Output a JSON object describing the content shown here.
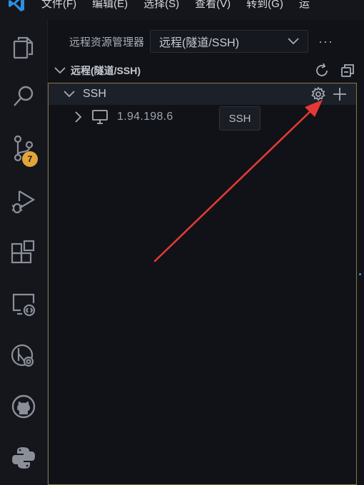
{
  "menu": {
    "items": [
      "文件(F)",
      "编辑(E)",
      "选择(S)",
      "查看(V)",
      "转到(G)",
      "运"
    ]
  },
  "activity_bar": {
    "items": [
      "explorer-icon",
      "search-icon",
      "source-control-icon",
      "run-debug-icon",
      "extensions-icon",
      "remote-explorer-icon",
      "timeline-icon",
      "github-icon",
      "python-icon"
    ],
    "scm_badge": "7"
  },
  "sidebar": {
    "view_title": "远程资源管理器",
    "view_select_value": "远程(隧道/SSH)",
    "more_label": "···",
    "section_title": "远程(隧道/SSH)",
    "ssh_group": "SSH",
    "host": "1.94.198.6",
    "tooltip": "SSH"
  },
  "colors": {
    "accent_border": "#8c7746",
    "badge": "#e3a53a",
    "annotation_arrow": "#e53935"
  }
}
